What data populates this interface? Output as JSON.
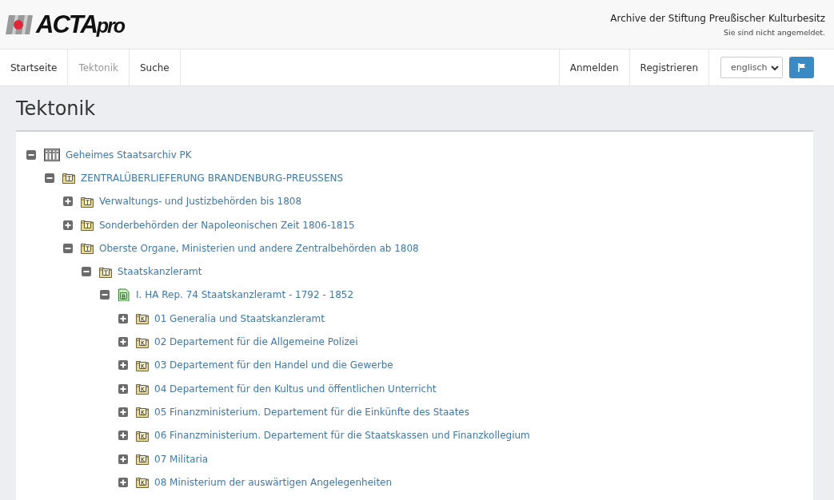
{
  "logo": {
    "main": "ACTA",
    "suffix": "pro"
  },
  "header": {
    "institution": "Archive der Stiftung Preußischer Kulturbesitz",
    "login_status": "Sie sind nicht angemeldet."
  },
  "nav": [
    {
      "label": "Startseite",
      "selected": false
    },
    {
      "label": "Tektonik",
      "selected": true
    },
    {
      "label": "Suche",
      "selected": false
    }
  ],
  "account_links": [
    "Anmelden",
    "Registrieren"
  ],
  "language_select": {
    "value": "englisch"
  },
  "page_title": "Tektonik",
  "tree": [
    {
      "kind": "archive",
      "label": "Geheimes Staatsarchiv PK",
      "expanded": true,
      "children": [
        {
          "kind": "folder",
          "badge": "T",
          "label": "ZENTRALÜBERLIEFERUNG BRANDENBURG-PREUSSENS",
          "expanded": true,
          "children": [
            {
              "kind": "folder",
              "badge": "T",
              "label": "Verwaltungs- und Justizbehörden bis 1808",
              "expanded": false
            },
            {
              "kind": "folder",
              "badge": "T",
              "label": "Sonderbehörden der Napoleonischen Zeit 1806-1815",
              "expanded": false
            },
            {
              "kind": "folder",
              "badge": "T",
              "label": "Oberste Organe, Ministerien und andere Zentralbehörden ab 1808",
              "expanded": true,
              "children": [
                {
                  "kind": "folder",
                  "badge": "T",
                  "label": "Staatskanzleramt",
                  "expanded": true,
                  "children": [
                    {
                      "kind": "document",
                      "badge": "B",
                      "label": "I. HA Rep. 74 Staatskanzleramt - 1792 - 1852",
                      "expanded": true,
                      "children": [
                        {
                          "kind": "folder",
                          "badge": "K",
                          "label": "01 Generalia und Staatskanzleramt",
                          "expanded": false
                        },
                        {
                          "kind": "folder",
                          "badge": "K",
                          "label": "02 Departement für die Allgemeine Polizei",
                          "expanded": false
                        },
                        {
                          "kind": "folder",
                          "badge": "K",
                          "label": "03 Departement für den Handel und die Gewerbe",
                          "expanded": false
                        },
                        {
                          "kind": "folder",
                          "badge": "K",
                          "label": "04 Departement für den Kultus und öffentlichen Unterricht",
                          "expanded": false
                        },
                        {
                          "kind": "folder",
                          "badge": "K",
                          "label": "05 Finanzministerium. Departement für die Einkünfte des Staates",
                          "expanded": false
                        },
                        {
                          "kind": "folder",
                          "badge": "K",
                          "label": "06 Finanzministerium. Departement für die Staatskassen und Finanzkollegium",
                          "expanded": false
                        },
                        {
                          "kind": "folder",
                          "badge": "K",
                          "label": "07 Militaria",
                          "expanded": false
                        },
                        {
                          "kind": "folder",
                          "badge": "K",
                          "label": "08 Ministerium der auswärtigen Angelegenheiten",
                          "expanded": false
                        }
                      ]
                    }
                  ]
                }
              ]
            }
          ]
        }
      ]
    }
  ]
}
